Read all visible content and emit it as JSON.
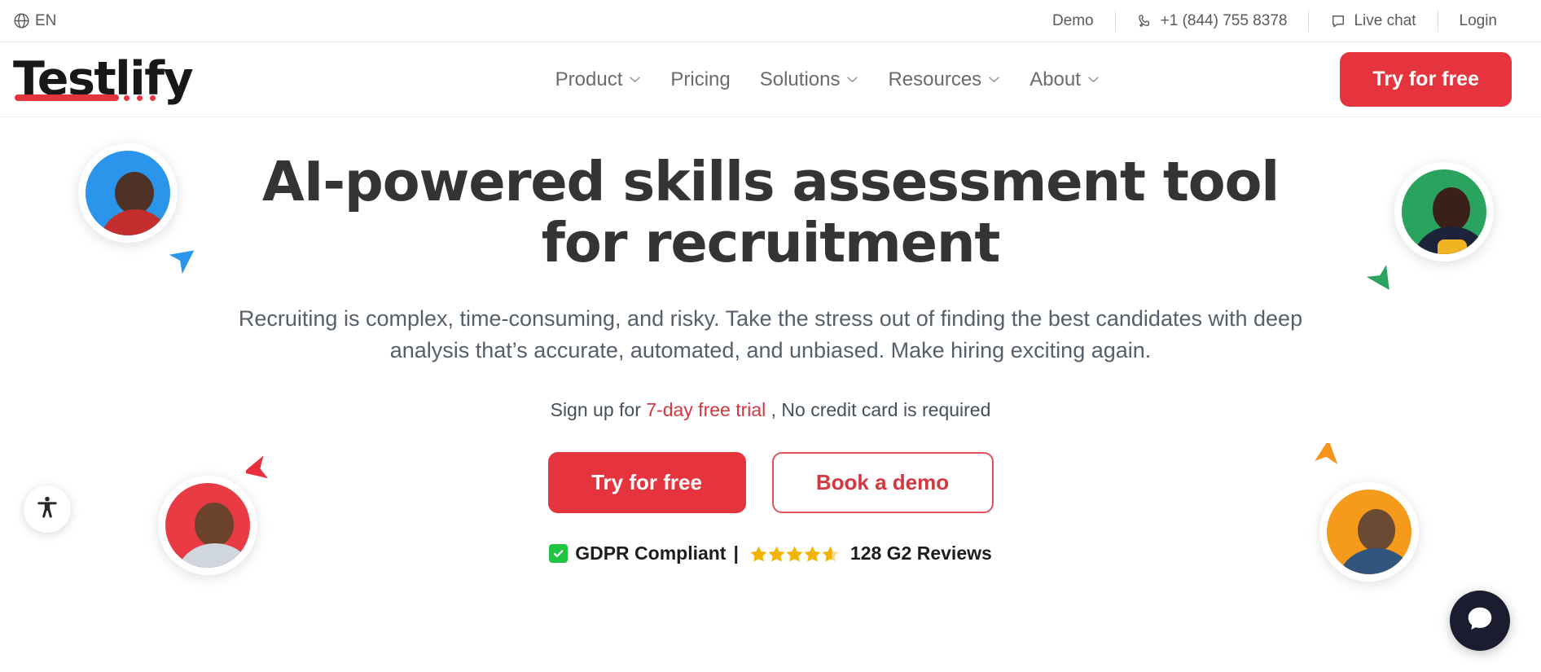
{
  "topbar": {
    "language": {
      "label": "EN",
      "icon": "globe-icon"
    },
    "links": [
      {
        "label": "Demo",
        "icon": null
      },
      {
        "label": "+1 (844) 755 8378",
        "icon": "phone-icon"
      },
      {
        "label": "Live chat",
        "icon": "chat-icon"
      },
      {
        "label": "Login",
        "icon": null
      }
    ]
  },
  "header": {
    "logo_text": "Testlify",
    "nav": [
      {
        "label": "Product",
        "has_dropdown": true
      },
      {
        "label": "Pricing",
        "has_dropdown": false
      },
      {
        "label": "Solutions",
        "has_dropdown": true
      },
      {
        "label": "Resources",
        "has_dropdown": true
      },
      {
        "label": "About",
        "has_dropdown": true
      }
    ],
    "cta_label": "Try for free"
  },
  "hero": {
    "title_line1": "AI-powered skills assessment tool",
    "title_line2": "for recruitment",
    "subtitle_line1": "Recruiting is complex, time-consuming, and risky. Take the stress out of finding the best candidates",
    "subtitle_line2": "with deep analysis that’s accurate, automated, and unbiased. Make hiring exciting again.",
    "trial_prefix": "Sign up for ",
    "trial_highlight": "7-day free trial",
    "trial_suffix": " , No credit card is required",
    "cta_primary": "Try for free",
    "cta_secondary": "Book a demo",
    "badge_gdpr": "GDPR Compliant",
    "badge_separator": "|",
    "badge_reviews": "128 G2 Reviews",
    "star_count": 5
  },
  "widgets": {
    "accessibility_icon": "accessibility-icon",
    "chat_icon": "chat-launcher-icon"
  },
  "colors": {
    "brand_red": "#e5343d",
    "trial_red": "#d4373f",
    "avatar_blue": "#2a95ea",
    "avatar_green": "#2aa35f",
    "avatar_red": "#e83b44",
    "avatar_orange": "#f59a1b",
    "star_gold": "#f5b301",
    "check_green": "#21c442",
    "text_dark": "#343434",
    "text_muted": "#55606b"
  },
  "decor": {
    "avatars": [
      {
        "name": "avatar-top-left",
        "color": "#2a95ea",
        "pointer": "#2a95ea"
      },
      {
        "name": "avatar-top-right",
        "color": "#2aa35f",
        "pointer": "#2aa35f"
      },
      {
        "name": "avatar-bottom-left",
        "color": "#e83b44",
        "pointer": "#e83b44"
      },
      {
        "name": "avatar-bottom-right",
        "color": "#f59a1b",
        "pointer": "#f59a1b"
      }
    ]
  }
}
